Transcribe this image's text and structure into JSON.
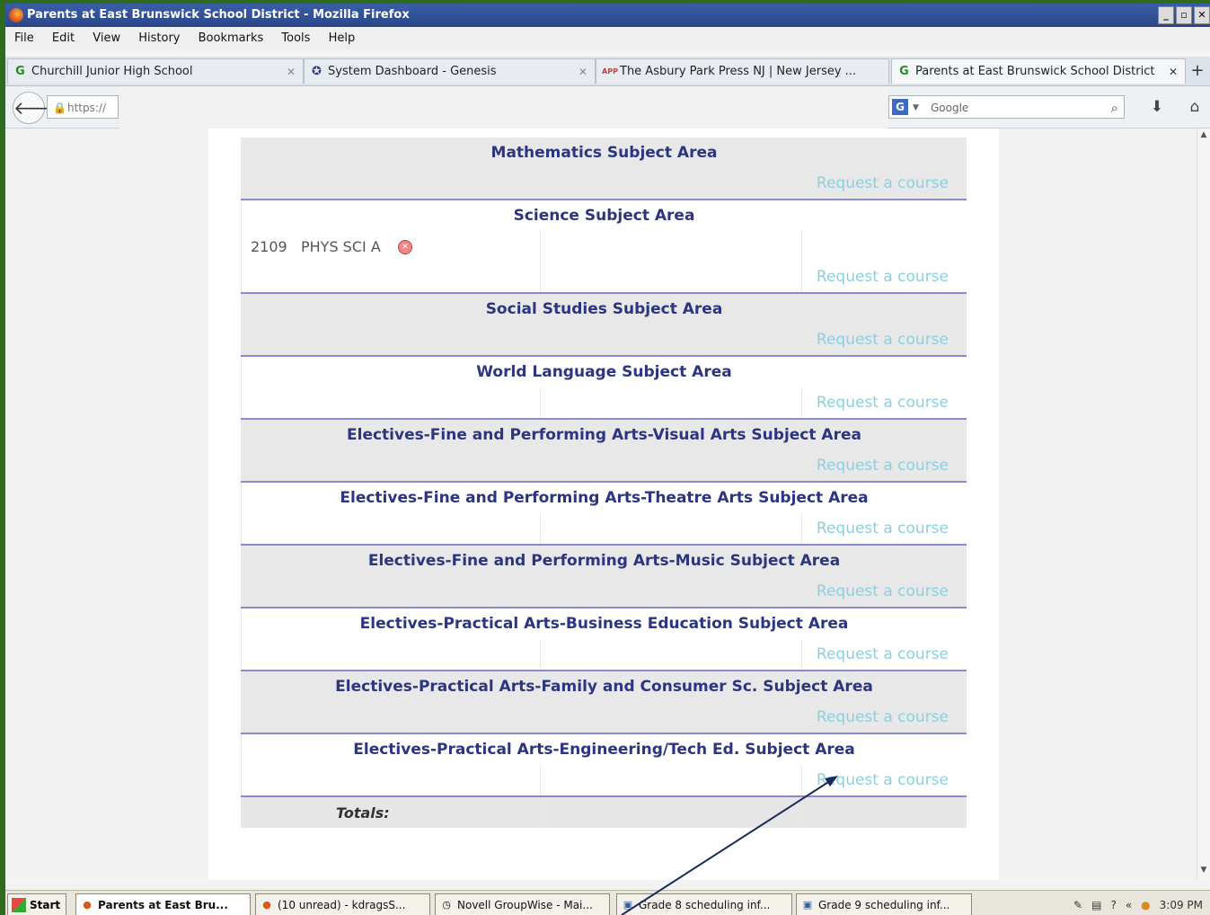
{
  "window": {
    "title": "Parents at East Brunswick School District - Mozilla Firefox"
  },
  "menu": [
    "File",
    "Edit",
    "View",
    "History",
    "Bookmarks",
    "Tools",
    "Help"
  ],
  "tabs": [
    {
      "label": "Churchill Junior High School"
    },
    {
      "label": "System Dashboard - Genesis"
    },
    {
      "label": "The Asbury Park Press NJ | New Jersey ..."
    },
    {
      "label": "Parents at East Brunswick School District"
    }
  ],
  "tab_icons": {
    "app": "APP"
  },
  "nav": {
    "url": "https://",
    "search_placeholder": "Google",
    "search_engine": "G"
  },
  "page": {
    "cut_heading": "Mathematics Subject Area",
    "request_label": "Request a course",
    "science_area": "Science Subject Area",
    "course_code": "2109",
    "course_name": "PHYS SCI A",
    "areas": [
      "Social Studies Subject Area",
      "World Language Subject Area",
      "Electives-Fine and Performing Arts-Visual Arts Subject Area",
      "Electives-Fine and Performing Arts-Theatre Arts Subject Area",
      "Electives-Fine and Performing Arts-Music Subject Area",
      "Electives-Practical Arts-Business Education Subject Area",
      "Electives-Practical Arts-Family and Consumer Sc. Subject Area",
      "Electives-Practical Arts-Engineering/Tech Ed. Subject Area"
    ],
    "totals_label": "Totals:"
  },
  "taskbar": {
    "start": "Start",
    "items": [
      "Parents at East Bru...",
      "(10 unread) - kdragsS...",
      "Novell GroupWise - Mai...",
      "Grade 8 scheduling inf...",
      "Grade 9 scheduling inf..."
    ],
    "clock": "3:09 PM"
  }
}
